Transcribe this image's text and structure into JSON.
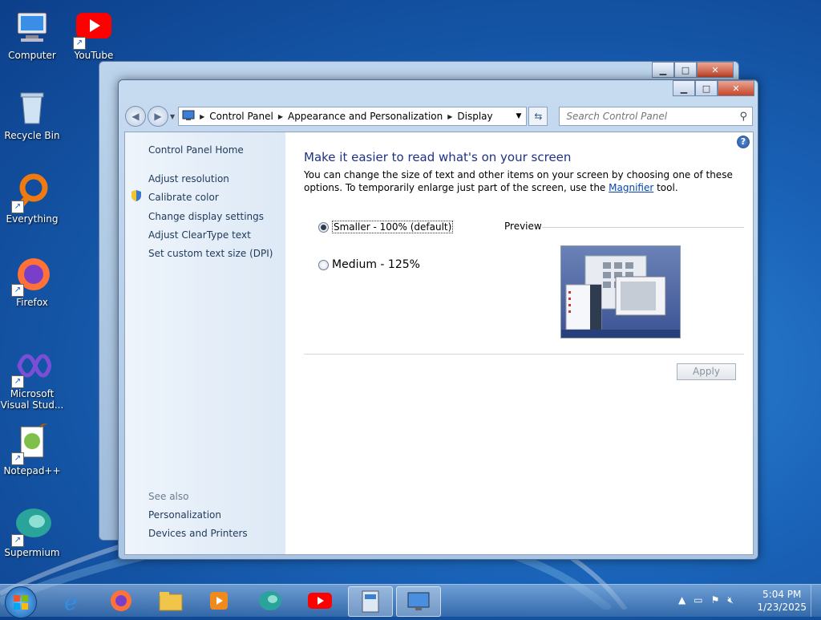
{
  "desktop_icons": [
    {
      "label": "Computer",
      "icon": "computer-icon"
    },
    {
      "label": "YouTube",
      "icon": "youtube-icon"
    },
    {
      "label": "Recycle Bin",
      "icon": "recycle-bin-icon"
    },
    {
      "label": "Everything",
      "icon": "everything-icon"
    },
    {
      "label": "Firefox",
      "icon": "firefox-icon"
    },
    {
      "label": "Microsoft Visual Stud...",
      "icon": "visual-studio-icon"
    },
    {
      "label": "Notepad++",
      "icon": "notepadpp-icon"
    },
    {
      "label": "Supermium",
      "icon": "supermium-icon"
    }
  ],
  "window": {
    "breadcrumb": [
      "Control Panel",
      "Appearance and Personalization",
      "Display"
    ],
    "search_placeholder": "Search Control Panel"
  },
  "sidebar": {
    "home": "Control Panel Home",
    "items": [
      "Adjust resolution",
      "Calibrate color",
      "Change display settings",
      "Adjust ClearType text",
      "Set custom text size (DPI)"
    ],
    "see_also_title": "See also",
    "see_also": [
      "Personalization",
      "Devices and Printers"
    ]
  },
  "main": {
    "heading": "Make it easier to read what's on your screen",
    "description_prefix": "You can change the size of text and other items on your screen by choosing one of these options. To temporarily enlarge just part of the screen, use the ",
    "magnifier_link": "Magnifier",
    "description_suffix": " tool.",
    "options": [
      {
        "label": "Smaller - 100% (default)",
        "selected": true
      },
      {
        "label": "Medium - 125%",
        "selected": false
      }
    ],
    "preview_label": "Preview",
    "apply_label": "Apply",
    "help_glyph": "?"
  },
  "taskbar": {
    "time": "5:04 PM",
    "date": "1/23/2025",
    "pinned": [
      "internet-explorer-icon",
      "firefox-icon",
      "file-explorer-icon",
      "media-player-icon",
      "supermium-icon",
      "youtube-icon",
      "control-panel-window-icon",
      "display-settings-icon"
    ]
  },
  "colors": {
    "heading": "#1e3287",
    "link": "#0645ad",
    "sidebar_text": "#1e395b"
  }
}
